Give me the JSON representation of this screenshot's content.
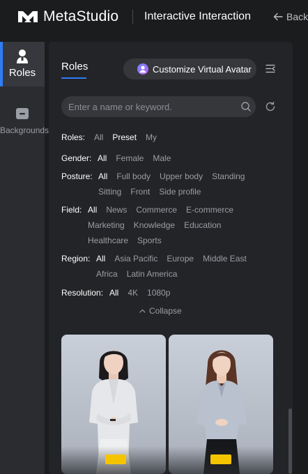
{
  "header": {
    "brand": "MetaStudio",
    "title": "Interactive Interaction",
    "back_label": "Back"
  },
  "sidenav": {
    "items": [
      {
        "label": "Roles",
        "icon": "person-icon",
        "active": true
      },
      {
        "label": "Backgrounds",
        "icon": "background-icon",
        "active": false
      }
    ]
  },
  "panel": {
    "tab_label": "Roles",
    "customize_label": "Customize Virtual Avatar",
    "search_placeholder": "Enter a name or keyword.",
    "collapse_label": "Collapse"
  },
  "filters": {
    "roles": {
      "label": "Roles:",
      "options": [
        "All",
        "Preset",
        "My"
      ],
      "selected": "Preset"
    },
    "gender": {
      "label": "Gender:",
      "options": [
        "All",
        "Female",
        "Male"
      ],
      "selected": "All"
    },
    "posture": {
      "label": "Posture:",
      "options": [
        "All",
        "Full body",
        "Upper body",
        "Standing",
        "Sitting",
        "Front",
        "Side profile"
      ],
      "selected": "All"
    },
    "field": {
      "label": "Field:",
      "options": [
        "All",
        "News",
        "Commerce",
        "E-commerce",
        "Marketing",
        "Knowledge",
        "Education",
        "Healthcare",
        "Sports"
      ],
      "selected": "All"
    },
    "region": {
      "label": "Region:",
      "options": [
        "All",
        "Asia Pacific",
        "Europe",
        "Middle East",
        "Africa",
        "Latin America"
      ],
      "selected": "All"
    },
    "resolution": {
      "label": "Resolution:",
      "options": [
        "All",
        "4K",
        "1080p"
      ],
      "selected": "All"
    }
  },
  "colors": {
    "accent": "#2f7cf6",
    "badge": "#f5c400",
    "background": "#1b1c1e",
    "panel": "#232427"
  }
}
